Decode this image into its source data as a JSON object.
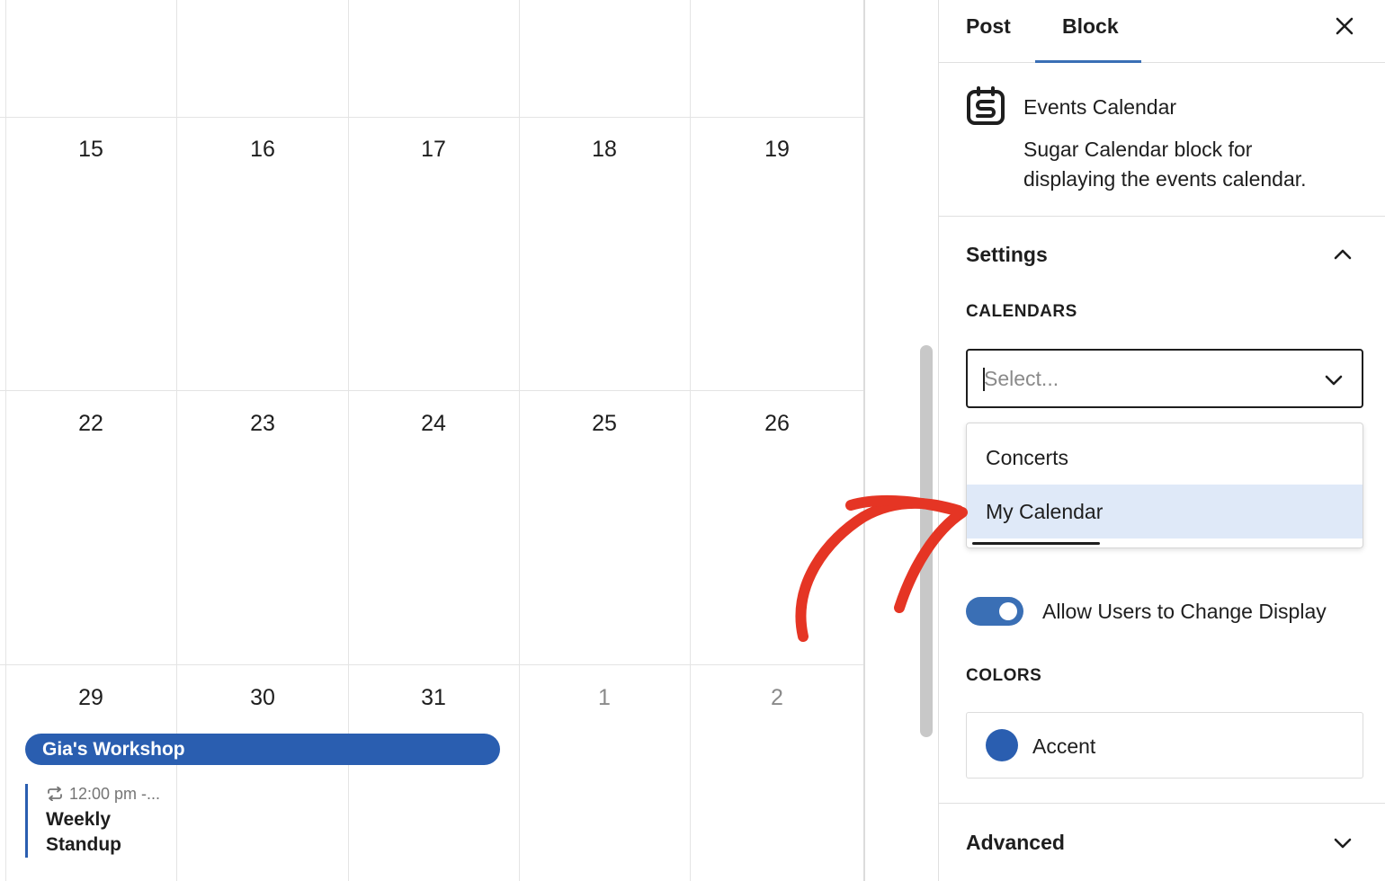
{
  "calendar": {
    "rows": [
      {
        "days": [
          {
            "num": "15",
            "muted": false
          },
          {
            "num": "16",
            "muted": false
          },
          {
            "num": "17",
            "muted": false
          },
          {
            "num": "18",
            "muted": false
          },
          {
            "num": "19",
            "muted": false
          }
        ]
      },
      {
        "days": [
          {
            "num": "22",
            "muted": false
          },
          {
            "num": "23",
            "muted": false
          },
          {
            "num": "24",
            "muted": false
          },
          {
            "num": "25",
            "muted": false
          },
          {
            "num": "26",
            "muted": false
          }
        ]
      },
      {
        "days": [
          {
            "num": "29",
            "muted": false
          },
          {
            "num": "30",
            "muted": false
          },
          {
            "num": "31",
            "muted": false
          },
          {
            "num": "1",
            "muted": true
          },
          {
            "num": "2",
            "muted": true
          }
        ]
      }
    ],
    "events": {
      "multi_day": {
        "title": "Gia's Workshop"
      },
      "standup": {
        "time": "12:00 pm -...",
        "title": "Weekly Standup",
        "icon": "repeat-icon"
      }
    },
    "colors": {
      "event": "#2a5eb0"
    }
  },
  "sidebar": {
    "tabs": [
      {
        "label": "Post",
        "active": false
      },
      {
        "label": "Block",
        "active": true
      }
    ],
    "close_icon": "close-icon",
    "block": {
      "icon": "sugar-calendar-logo-icon",
      "title": "Events Calendar",
      "description": "Sugar Calendar block for displaying the events calendar."
    },
    "settings": {
      "title": "Settings",
      "expanded": true,
      "calendars_label": "CALENDARS",
      "select": {
        "placeholder": "Select...",
        "value": ""
      },
      "dropdown_options": [
        {
          "label": "Concerts",
          "highlighted": false
        },
        {
          "label": "My Calendar",
          "highlighted": true
        }
      ],
      "toggle": {
        "label": "Allow Users to Change Display",
        "on": true
      },
      "colors_label": "COLORS",
      "colors": [
        {
          "label": "Accent",
          "value": "#2a5eb0"
        }
      ]
    },
    "advanced": {
      "title": "Advanced",
      "expanded": false
    }
  },
  "annotation": {
    "type": "arrow",
    "color": "#e53524",
    "points_to": "My Calendar"
  },
  "theme": {
    "accent": "#3a6fb5",
    "highlight": "#dfe9f8",
    "border": "#e0e0e0"
  }
}
